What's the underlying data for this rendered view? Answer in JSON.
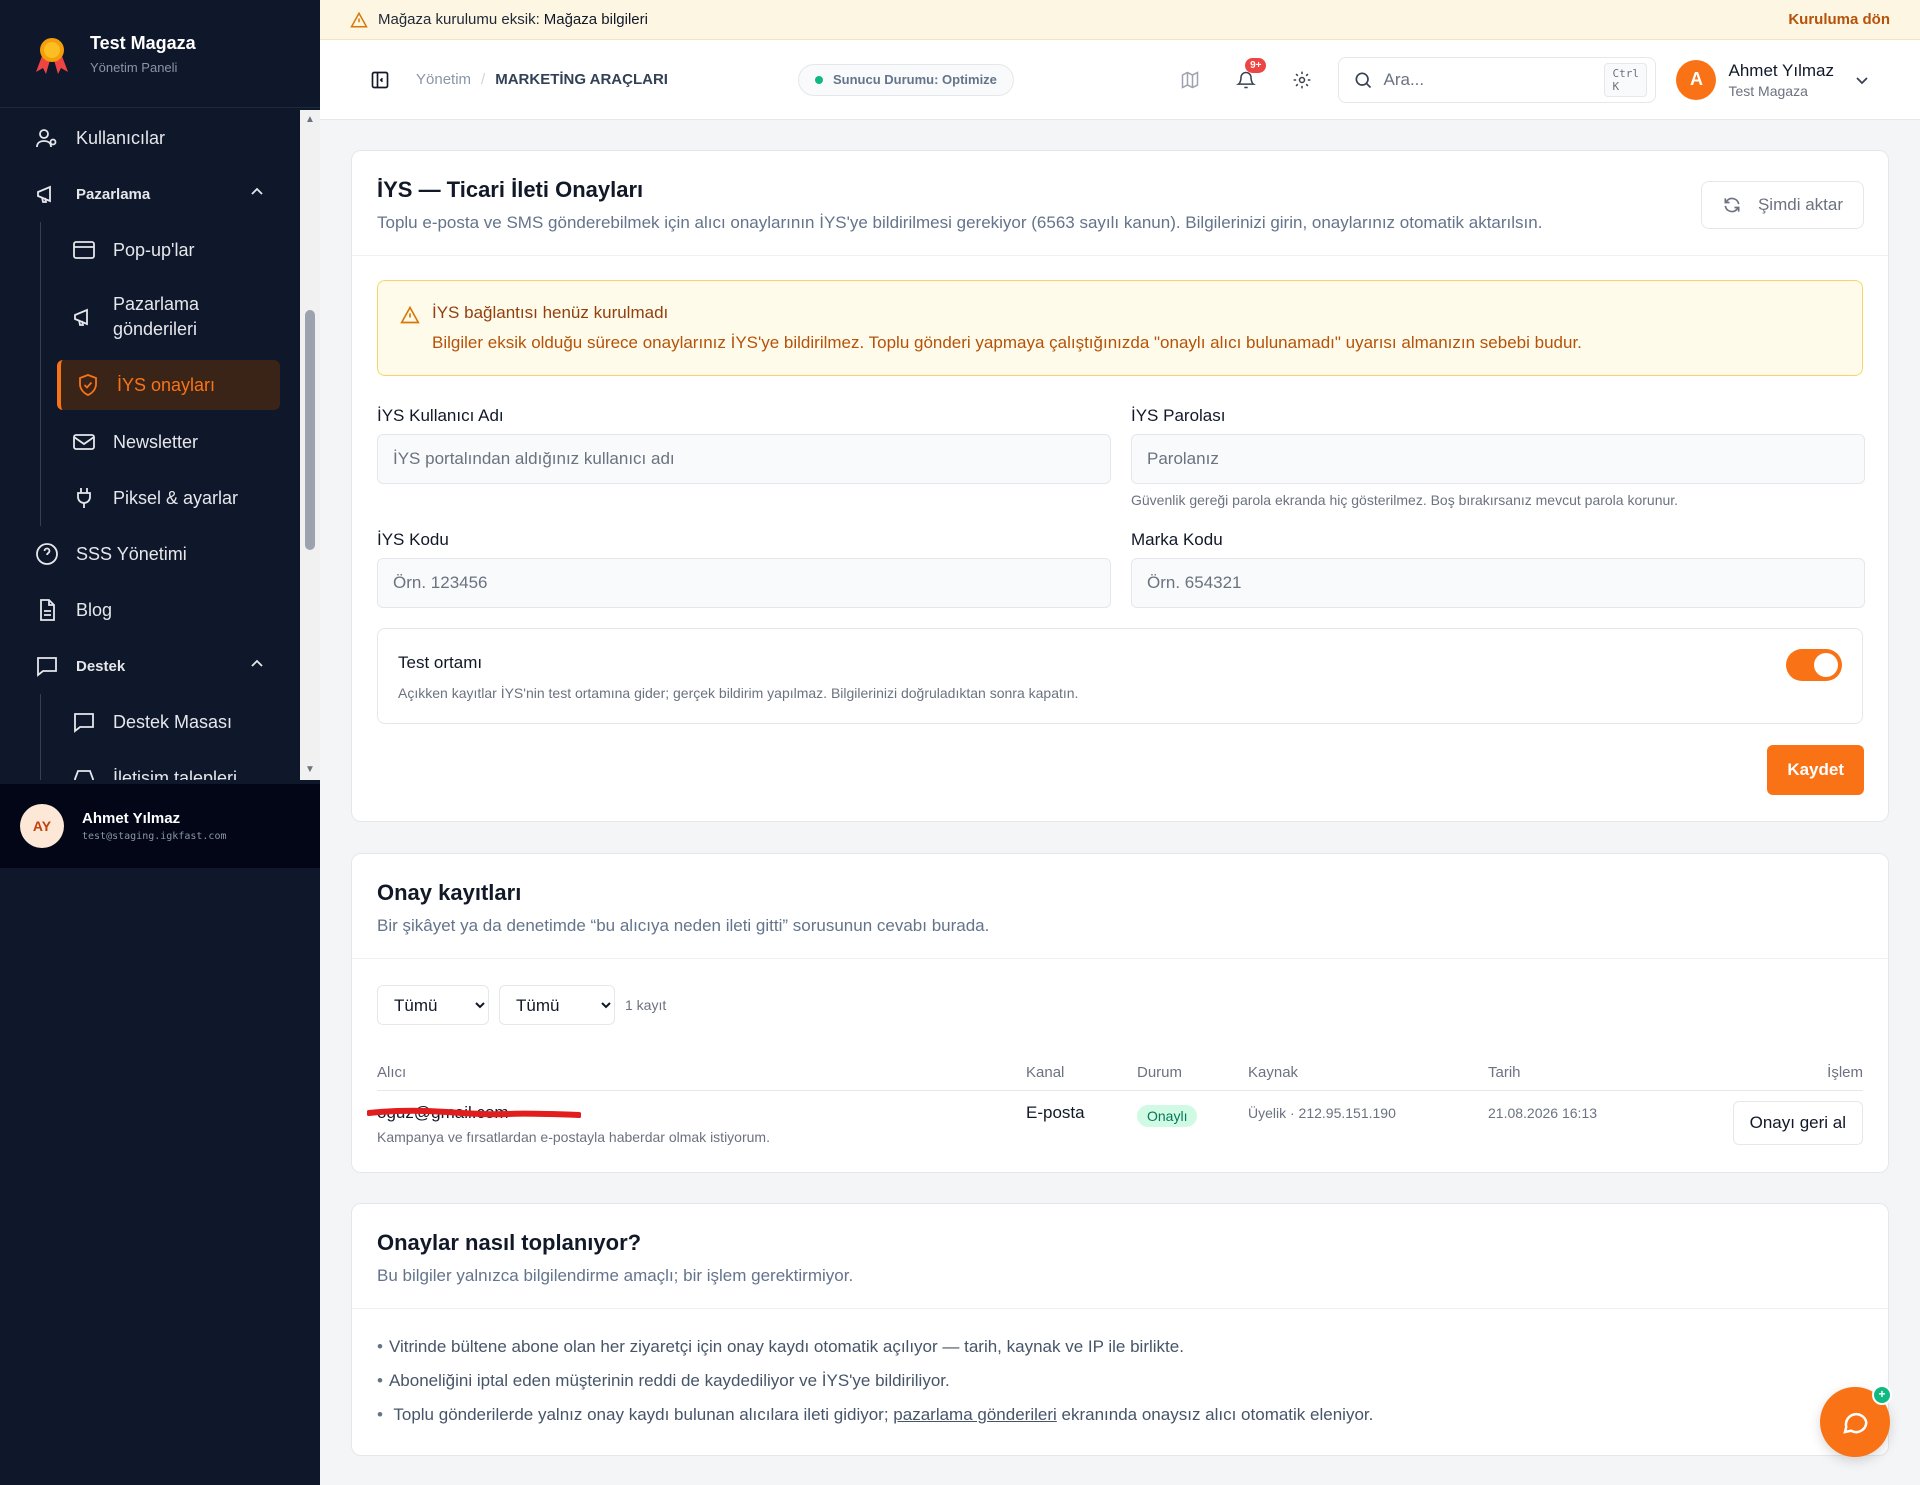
{
  "brand": {
    "title": "Test Magaza",
    "subtitle": "Yönetim Paneli"
  },
  "sidebar": {
    "items": [
      {
        "label": "Kullanıcılar",
        "icon": "users-icon"
      },
      {
        "label": "Pazarlama",
        "icon": "megaphone-icon",
        "group": true,
        "expanded": true
      },
      {
        "label": "Pop-up'lar",
        "icon": "window-icon"
      },
      {
        "label": "Pazarlama gönderileri",
        "icon": "megaphone-icon"
      },
      {
        "label": "İYS onayları",
        "icon": "shield-check-icon",
        "active": true
      },
      {
        "label": "Newsletter",
        "icon": "mail-icon"
      },
      {
        "label": "Piksel & ayarlar",
        "icon": "plug-icon"
      },
      {
        "label": "SSS Yönetimi",
        "icon": "help-circle-icon"
      },
      {
        "label": "Blog",
        "icon": "document-icon"
      },
      {
        "label": "Destek",
        "icon": "chat-icon",
        "group": true,
        "expanded": true
      },
      {
        "label": "Destek Masası",
        "icon": "chat-icon"
      },
      {
        "label": "İletişim talepleri",
        "icon": "inbox-icon"
      }
    ],
    "user": {
      "initials": "AY",
      "name": "Ahmet Yılmaz",
      "email": "test@staging.igkfast.com"
    }
  },
  "banner": {
    "text": "Mağaza kurulumu eksik:",
    "link": "Mağaza bilgileri",
    "action": "Kuruluma dön"
  },
  "header": {
    "breadcrumb": [
      "Yönetim",
      "MARKETİNG ARAÇLARI"
    ],
    "server_status": "Sunucu Durumu: Optimize",
    "notifications_badge": "9+",
    "search_placeholder": "Ara...",
    "search_shortcut": "Ctrl K",
    "user": {
      "initial": "A",
      "name": "Ahmet Yılmaz",
      "store": "Test Magaza"
    }
  },
  "iys": {
    "title": "İYS — Ticari İleti Onayları",
    "description": "Toplu e-posta ve SMS gönderebilmek için alıcı onaylarının İYS'ye bildirilmesi gerekiyor (6563 sayılı kanun). Bilgilerinizi girin, onaylarınız otomatik aktarılsın.",
    "sync_button": "Şimdi aktar",
    "alert_title": "İYS bağlantısı henüz kurulmadı",
    "alert_text": "Bilgiler eksik olduğu sürece onaylarınız İYS'ye bildirilmez. Toplu gönderi yapmaya çalıştığınızda \"onaylı alıcı bulunamadı\" uyarısı almanızın sebebi budur.",
    "fields": {
      "username_label": "İYS Kullanıcı Adı",
      "username_placeholder": "İYS portalından aldığınız kullanıcı adı",
      "password_label": "İYS Parolası",
      "password_placeholder": "Parolanız",
      "password_hint": "Güvenlik gereği parola ekranda hiç gösterilmez. Boş bırakırsanız mevcut parola korunur.",
      "code_label": "İYS Kodu",
      "code_placeholder": "Örn. 123456",
      "brand_label": "Marka Kodu",
      "brand_placeholder": "Örn. 654321"
    },
    "test_mode": {
      "title": "Test ortamı",
      "description": "Açıkken kayıtlar İYS'nin test ortamına gider; gerçek bildirim yapılmaz. Bilgilerinizi doğruladıktan sonra kapatın.",
      "enabled": true
    },
    "save_button": "Kaydet"
  },
  "records": {
    "title": "Onay kayıtları",
    "description": "Bir şikâyet ya da denetimde “bu alıcıya neden ileti gitti” sorusunun cevabı burada.",
    "filter1": "Tümü",
    "filter2": "Tümü",
    "count": "1 kayıt",
    "columns": [
      "Alıcı",
      "Kanal",
      "Durum",
      "Kaynak",
      "Tarih",
      "İşlem"
    ],
    "rows": [
      {
        "recipient": "oguz@gmail.com",
        "note": "Kampanya ve fırsatlardan e-postayla haberdar olmak istiyorum.",
        "channel": "E-posta",
        "status": "Onaylı",
        "source": "Üyelik · 212.95.151.190",
        "date": "21.08.2026 16:13",
        "action": "Onayı geri al"
      }
    ]
  },
  "info": {
    "title": "Onaylar nasıl toplanıyor?",
    "description": "Bu bilgiler yalnızca bilgilendirme amaçlı; bir işlem gerektirmiyor.",
    "bullets": [
      "Vitrinde bültene abone olan her ziyaretçi için onay kaydı otomatik açılıyor — tarih, kaynak ve IP ile birlikte.",
      "Aboneliğini iptal eden müşterinin reddi de kaydediliyor ve İYS'ye bildiriliyor."
    ],
    "bullet3_before": "Toplu gönderilerde yalnız onay kaydı bulunan alıcılara ileti gidiyor;",
    "bullet3_link": "pazarlama gönderileri",
    "bullet3_after": "ekranında onaysız alıcı otomatik eleniyor."
  },
  "colors": {
    "accent": "#f97316",
    "sidebar": "#0f172a",
    "success": "#10b981",
    "warning_bg": "#fffbeb"
  }
}
